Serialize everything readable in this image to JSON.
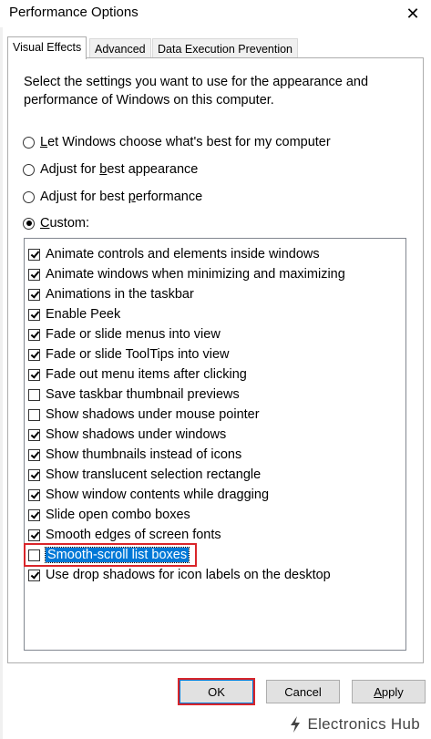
{
  "window": {
    "title": "Performance Options",
    "close_glyph": "✕"
  },
  "tabs": [
    {
      "label": "Visual Effects",
      "active": true
    },
    {
      "label": "Advanced",
      "active": false
    },
    {
      "label": "Data Execution Prevention",
      "active": false
    }
  ],
  "intro_text": "Select the settings you want to use for the appearance and performance of Windows on this computer.",
  "radios": [
    {
      "pre": "",
      "u": "L",
      "post": "et Windows choose what's best for my computer",
      "checked": false
    },
    {
      "pre": "Adjust for ",
      "u": "b",
      "post": "est appearance",
      "checked": false
    },
    {
      "pre": "Adjust for best ",
      "u": "p",
      "post": "erformance",
      "checked": false
    },
    {
      "pre": "",
      "u": "C",
      "post": "ustom:",
      "checked": true
    }
  ],
  "options": [
    {
      "label": "Animate controls and elements inside windows",
      "checked": true
    },
    {
      "label": "Animate windows when minimizing and maximizing",
      "checked": true
    },
    {
      "label": "Animations in the taskbar",
      "checked": true
    },
    {
      "label": "Enable Peek",
      "checked": true
    },
    {
      "label": "Fade or slide menus into view",
      "checked": true
    },
    {
      "label": "Fade or slide ToolTips into view",
      "checked": true
    },
    {
      "label": "Fade out menu items after clicking",
      "checked": true
    },
    {
      "label": "Save taskbar thumbnail previews",
      "checked": false
    },
    {
      "label": "Show shadows under mouse pointer",
      "checked": false
    },
    {
      "label": "Show shadows under windows",
      "checked": true
    },
    {
      "label": "Show thumbnails instead of icons",
      "checked": true
    },
    {
      "label": "Show translucent selection rectangle",
      "checked": true
    },
    {
      "label": "Show window contents while dragging",
      "checked": true
    },
    {
      "label": "Slide open combo boxes",
      "checked": true
    },
    {
      "label": "Smooth edges of screen fonts",
      "checked": true
    },
    {
      "label": "Smooth-scroll list boxes",
      "checked": false,
      "selected": true
    },
    {
      "label": "Use drop shadows for icon labels on the desktop",
      "checked": true
    }
  ],
  "buttons": {
    "ok": "OK",
    "cancel": "Cancel",
    "apply_u": "A",
    "apply_rest": "pply"
  },
  "watermark": {
    "text": "Electronics Hub"
  },
  "colors": {
    "selection": "#0078d7",
    "highlight": "#d9252a"
  }
}
